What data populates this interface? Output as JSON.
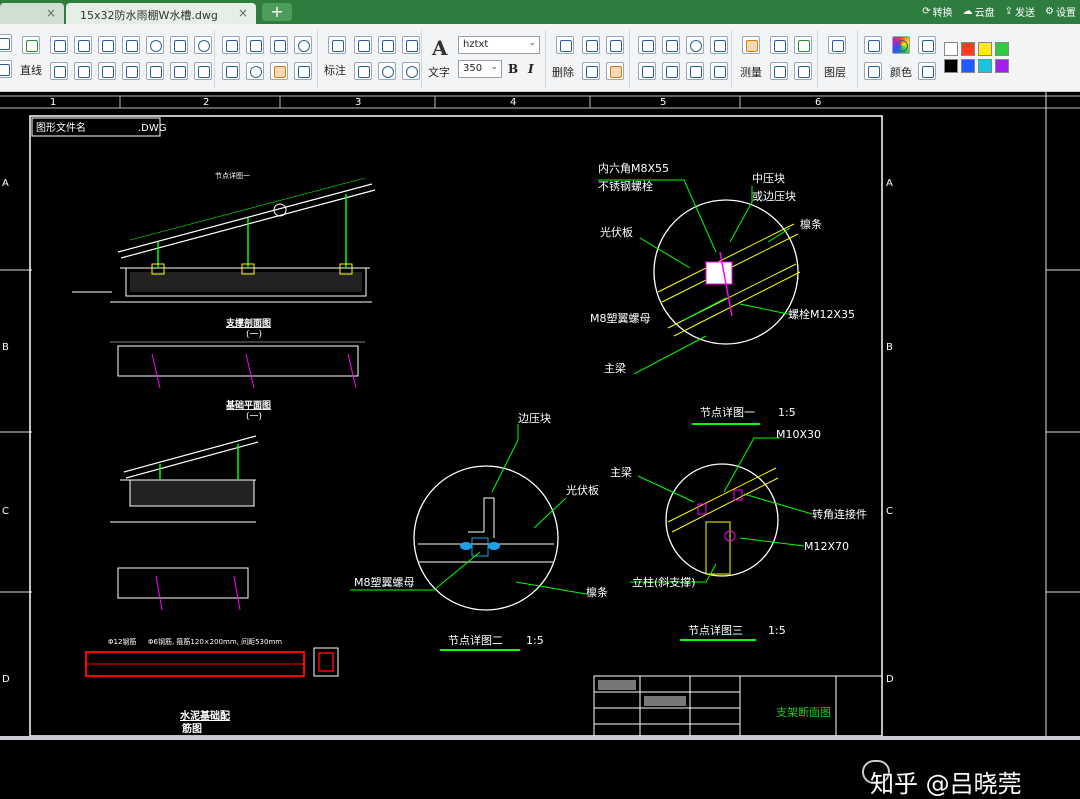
{
  "tabs": [
    {
      "label": "",
      "close": "×"
    },
    {
      "label": "15x32防水雨棚W水槽.dwg",
      "close": "×"
    }
  ],
  "new_tab": "+",
  "top_actions": [
    {
      "icon": "convert-icon",
      "label": "转换"
    },
    {
      "icon": "cloud-icon",
      "label": "云盘"
    },
    {
      "icon": "send-icon",
      "label": "发送"
    },
    {
      "icon": "gear-icon",
      "label": "设置"
    }
  ],
  "ribbon": {
    "line_label": "直线",
    "dimension_label": "标注",
    "text_label": "文字",
    "font_name": "hztxt",
    "font_size": "350",
    "bold": "B",
    "italic": "I",
    "delete_label": "删除",
    "measure_label": "测量",
    "layer_label": "图层",
    "color_label": "颜色",
    "swatches": [
      "#ffffff",
      "#ff3b1f",
      "#ffee00",
      "#2ecc40",
      "#000000",
      "#1e5cff",
      "#15c6e0",
      "#a020f0"
    ]
  },
  "drawing": {
    "col_numbers": [
      "1",
      "2",
      "3",
      "4",
      "5",
      "6"
    ],
    "row_letters": [
      "A",
      "B",
      "C",
      "D"
    ],
    "file_label": "图形文件名",
    "file_ext": ".DWG",
    "labels": {
      "node_detail1_top": "节点详图一",
      "support_section": "支撑剖面图",
      "section_one": "(一)",
      "foundation_plan": "基础平面图",
      "foundation_one": "(一)",
      "cement_base": "水泥基础配",
      "rebar_drawing": "筋图",
      "rebar1": "Φ12钢筋",
      "rebar2": "Φ6钢筋, 箍筋120×200mm, 间距530mm",
      "hex_bolt": "内六角M8X55",
      "stainless_bolt": "不锈钢螺栓",
      "mid_clamp": "中压块",
      "or_edge_clamp": "或边压块",
      "pv_panel": "光伏板",
      "purlin": "檩条",
      "m8_nut": "M8塑翼螺母",
      "bolt_m12x35": "螺栓M12X35",
      "main_beam": "主梁",
      "node_detail_one": "节点详图一",
      "scale1": "1:5",
      "m10x30": "M10X30",
      "edge_clamp": "边压块",
      "main_beam2": "主梁",
      "pv_panel2": "光伏板",
      "corner_connector": "转角连接件",
      "m12x70": "M12X70",
      "m8_nut2": "M8塑翼螺母",
      "purlin2": "檩条",
      "column_brace": "立柱(斜支撑)",
      "node_detail_two": "节点详图二",
      "scale2": "1:5",
      "node_detail_three": "节点详图三",
      "scale3": "1:5",
      "title_block_name": "支架断面图"
    }
  },
  "watermark": "知乎 @吕晓莞"
}
